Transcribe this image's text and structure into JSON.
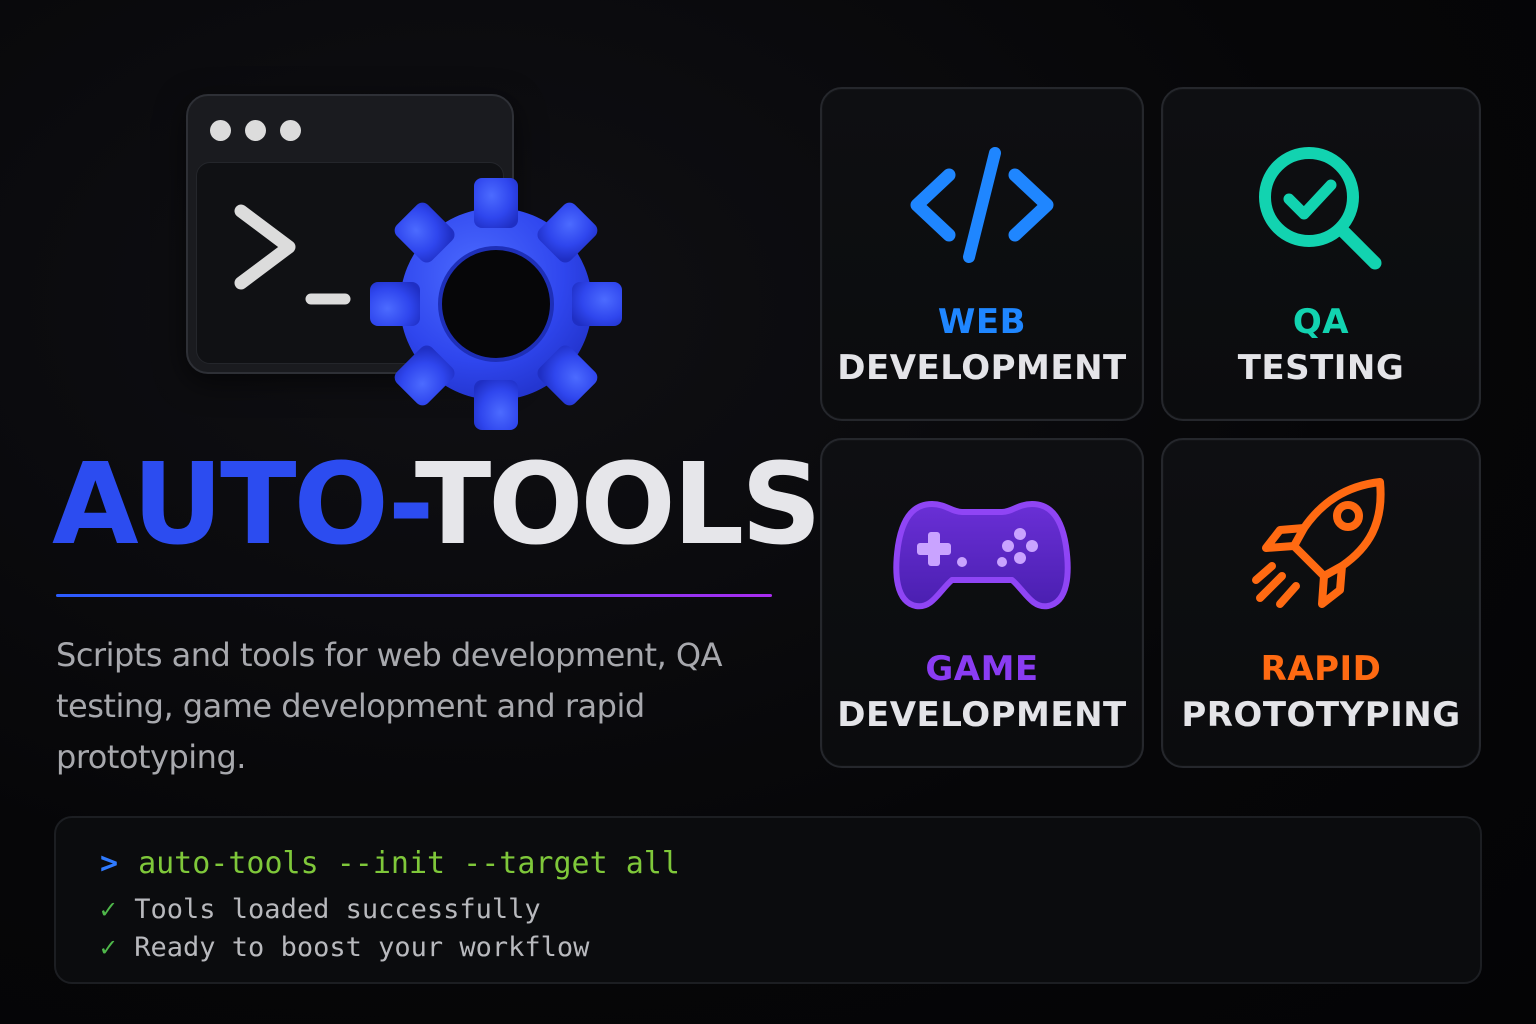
{
  "brand": {
    "title_part_a": "AUTO-",
    "title_part_b": "TOOLS",
    "tagline": "Scripts and tools for web development, QA testing, game development and rapid prototyping.",
    "accent_blue": "#2c4cf0",
    "divider_gradient": [
      "#2b5cff",
      "#a92cf0"
    ]
  },
  "hero_icon": {
    "window_icon": "terminal-window-icon",
    "prompt_glyph": ">_",
    "gear_icon": "gear-icon",
    "gear_color": "#2f4cf2"
  },
  "cards": [
    {
      "id": "web",
      "icon": "code-brackets-icon",
      "color": "#1f86ff",
      "line1": "WEB",
      "line2": "DEVELOPMENT"
    },
    {
      "id": "qa",
      "icon": "magnifier-check-icon",
      "color": "#12d3b0",
      "line1": "QA",
      "line2": "TESTING"
    },
    {
      "id": "game",
      "icon": "gamepad-icon",
      "color": "#8a3cf2",
      "line1": "GAME",
      "line2": "DEVELOPMENT"
    },
    {
      "id": "proto",
      "icon": "rocket-icon",
      "color": "#ff6a12",
      "line1": "RAPID",
      "line2": "PROTOTYPING"
    }
  ],
  "console": {
    "prompt_symbol": ">",
    "command": "auto-tools --init --target all",
    "outputs": [
      {
        "check": "✓",
        "text": "Tools loaded successfully"
      },
      {
        "check": "✓",
        "text": "Ready to boost your workflow"
      }
    ],
    "colors": {
      "prompt": "#2f7bff",
      "command": "#7fc83a",
      "check": "#4fb84a"
    }
  }
}
